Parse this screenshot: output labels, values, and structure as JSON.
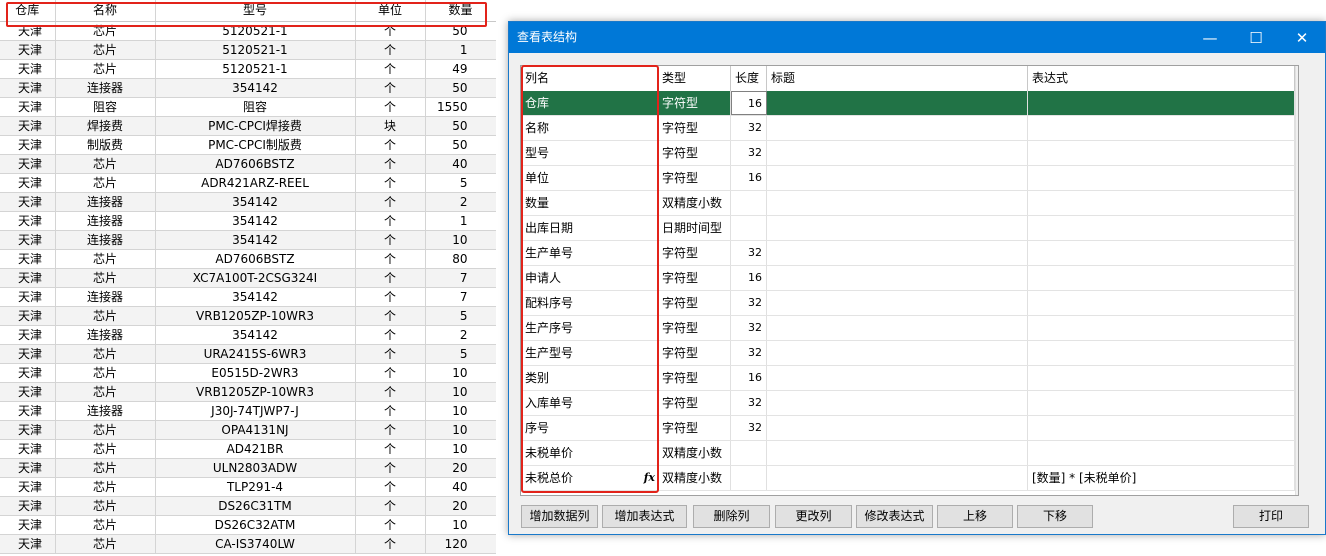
{
  "sheet": {
    "headers": [
      "仓库",
      "名称",
      "型号",
      "单位",
      "数量"
    ],
    "rows": [
      [
        "天津",
        "芯片",
        "5120521-1",
        "个",
        "50"
      ],
      [
        "天津",
        "芯片",
        "5120521-1",
        "个",
        "1"
      ],
      [
        "天津",
        "芯片",
        "5120521-1",
        "个",
        "49"
      ],
      [
        "天津",
        "连接器",
        "354142",
        "个",
        "50"
      ],
      [
        "天津",
        "阻容",
        "阻容",
        "个",
        "1550"
      ],
      [
        "天津",
        "焊接费",
        "PMC-CPCI焊接费",
        "块",
        "50"
      ],
      [
        "天津",
        "制版费",
        "PMC-CPCI制版费",
        "个",
        "50"
      ],
      [
        "天津",
        "芯片",
        "AD7606BSTZ",
        "个",
        "40"
      ],
      [
        "天津",
        "芯片",
        "ADR421ARZ-REEL",
        "个",
        "5"
      ],
      [
        "天津",
        "连接器",
        "354142",
        "个",
        "2"
      ],
      [
        "天津",
        "连接器",
        "354142",
        "个",
        "1"
      ],
      [
        "天津",
        "连接器",
        "354142",
        "个",
        "10"
      ],
      [
        "天津",
        "芯片",
        "AD7606BSTZ",
        "个",
        "80"
      ],
      [
        "天津",
        "芯片",
        "XC7A100T-2CSG324I",
        "个",
        "7"
      ],
      [
        "天津",
        "连接器",
        "354142",
        "个",
        "7"
      ],
      [
        "天津",
        "芯片",
        "VRB1205ZP-10WR3",
        "个",
        "5"
      ],
      [
        "天津",
        "连接器",
        "354142",
        "个",
        "2"
      ],
      [
        "天津",
        "芯片",
        "URA2415S-6WR3",
        "个",
        "5"
      ],
      [
        "天津",
        "芯片",
        "E0515D-2WR3",
        "个",
        "10"
      ],
      [
        "天津",
        "芯片",
        "VRB1205ZP-10WR3",
        "个",
        "10"
      ],
      [
        "天津",
        "连接器",
        "J30J-74TJWP7-J",
        "个",
        "10"
      ],
      [
        "天津",
        "芯片",
        "OPA4131NJ",
        "个",
        "10"
      ],
      [
        "天津",
        "芯片",
        "AD421BR",
        "个",
        "10"
      ],
      [
        "天津",
        "芯片",
        "ULN2803ADW",
        "个",
        "20"
      ],
      [
        "天津",
        "芯片",
        "TLP291-4",
        "个",
        "40"
      ],
      [
        "天津",
        "芯片",
        "DS26C31TM",
        "个",
        "20"
      ],
      [
        "天津",
        "芯片",
        "DS26C32ATM",
        "个",
        "10"
      ],
      [
        "天津",
        "芯片",
        "CA-IS3740LW",
        "个",
        "120"
      ]
    ]
  },
  "dialog": {
    "title": "查看表结构",
    "window_buttons": {
      "minimize": "—",
      "maximize": "☐",
      "close": "✕"
    },
    "grid": {
      "headers": [
        "列名",
        "类型",
        "长度",
        "标题",
        "表达式"
      ],
      "selected_row": 0,
      "rows": [
        [
          "仓库",
          "字符型",
          "16",
          "",
          ""
        ],
        [
          "名称",
          "字符型",
          "32",
          "",
          ""
        ],
        [
          "型号",
          "字符型",
          "32",
          "",
          ""
        ],
        [
          "单位",
          "字符型",
          "16",
          "",
          ""
        ],
        [
          "数量",
          "双精度小数",
          "",
          "",
          ""
        ],
        [
          "出库日期",
          "日期时间型",
          "",
          "",
          ""
        ],
        [
          "生产单号",
          "字符型",
          "32",
          "",
          ""
        ],
        [
          "申请人",
          "字符型",
          "16",
          "",
          ""
        ],
        [
          "配料序号",
          "字符型",
          "32",
          "",
          ""
        ],
        [
          "生产序号",
          "字符型",
          "32",
          "",
          ""
        ],
        [
          "生产型号",
          "字符型",
          "32",
          "",
          ""
        ],
        [
          "类别",
          "字符型",
          "16",
          "",
          ""
        ],
        [
          "入库单号",
          "字符型",
          "32",
          "",
          ""
        ],
        [
          "序号",
          "字符型",
          "32",
          "",
          ""
        ],
        [
          "未税单价",
          "双精度小数",
          "",
          "",
          ""
        ],
        [
          "未税总价",
          "双精度小数",
          "",
          "",
          "[数量] * [未税单价]"
        ]
      ],
      "fx_icon_text": "fx",
      "scroll": {
        "up": "▲",
        "down": "▼"
      }
    },
    "buttons": {
      "add_data_column": "增加数据列",
      "add_expression": "增加表达式",
      "delete_column": "删除列",
      "modify_column": "更改列",
      "modify_expression": "修改表达式",
      "move_up": "上移",
      "move_down": "下移",
      "print": "打印"
    }
  },
  "colors": {
    "titlebar": "#0078d7",
    "selected_row": "#217346",
    "highlight_box": "#e2231a"
  }
}
